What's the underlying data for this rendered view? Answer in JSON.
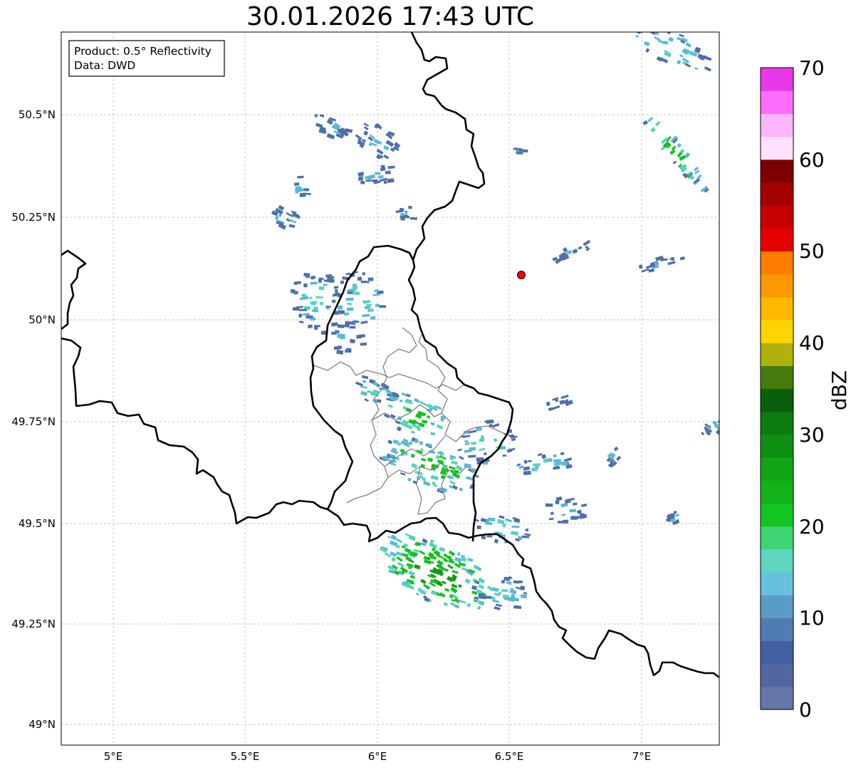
{
  "title": "30.01.2026 17:43 UTC",
  "info_box": {
    "line1": "Product: 0.5° Reflectivity",
    "line2": "Data: DWD"
  },
  "axes": {
    "x_ticks": [
      "5°E",
      "5.5°E",
      "6°E",
      "6.5°E",
      "7°E"
    ],
    "y_ticks": [
      "50.5°N",
      "50.25°N",
      "50°N",
      "49.75°N",
      "49.5°N",
      "49.25°N",
      "49°N"
    ]
  },
  "colorbar": {
    "label": "dBZ",
    "ticks": [
      "0",
      "10",
      "20",
      "30",
      "40",
      "50",
      "60",
      "70"
    ],
    "colors": [
      "#6577a8",
      "#5466a0",
      "#445ea2",
      "#4f7cb2",
      "#5a9cc8",
      "#66c2dc",
      "#5fd6c0",
      "#3ed474",
      "#11c61f",
      "#12b21b",
      "#10a515",
      "#0e9012",
      "#0c7c10",
      "#095f0b",
      "#467a0c",
      "#afb10a",
      "#ffd400",
      "#ffb700",
      "#ff9800",
      "#ff7c00",
      "#e40000",
      "#c60000",
      "#a30000",
      "#7c0000",
      "#ffe0ff",
      "#ffb4ff",
      "#ff6dff",
      "#e838e8"
    ]
  },
  "radar_site": {
    "color": "#ff0000"
  },
  "basemap_colors": {
    "border": "#000000",
    "region_border": "#808080",
    "grid": "#b0b0b0",
    "echo_weak": "#4f6faa",
    "echo_light": "#5ab8d8",
    "echo_teal": "#55d3bd",
    "echo_green": "#12c31e",
    "echo_dark": "#0e9c14"
  }
}
